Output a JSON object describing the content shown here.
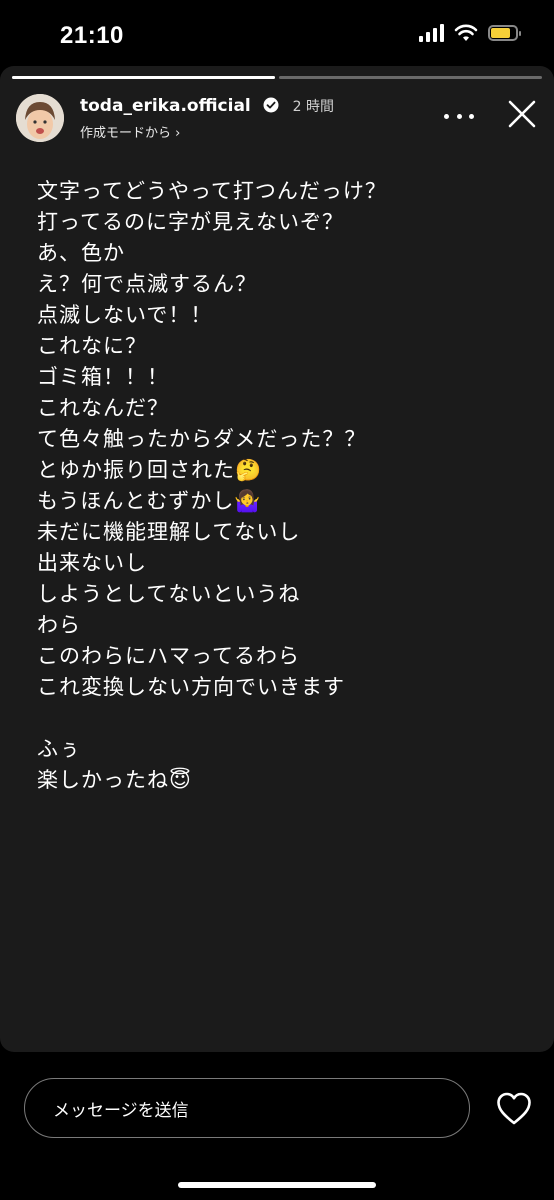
{
  "status_bar": {
    "time": "21:10",
    "battery_level": 0.8,
    "icons": [
      "cellular-signal-icon",
      "wifi-icon",
      "battery-icon"
    ]
  },
  "story": {
    "progress_segments": [
      1.0,
      0.0
    ],
    "user": {
      "username": "toda_erika.official",
      "time_ago": "2 時間",
      "subline": "作成モードから ›",
      "verified": true
    },
    "text_lines": [
      "文字ってどうやって打つんだっけ？",
      "打ってるのに字が見えないぞ？",
      "あ、色か",
      "え？何で点滅するん？",
      "点滅しないで！！",
      "これなに？",
      "ゴミ箱！！！",
      "これなんだ？",
      "て色々触ったからダメだった？？",
      "とゆか振り回された🤔",
      "もうほんとむずかし🤷‍♀️",
      "未だに機能理解してないし",
      "出来ないし",
      "しようとしてないというね",
      "わら",
      "このわらにハマってるわら",
      "これ変換しない方向でいきます",
      "",
      "ふぅ",
      "楽しかったね😇"
    ],
    "colors": {
      "background": "#1b1b1b",
      "text": "#ffffff"
    }
  },
  "reply": {
    "placeholder": "メッセージを送信"
  }
}
